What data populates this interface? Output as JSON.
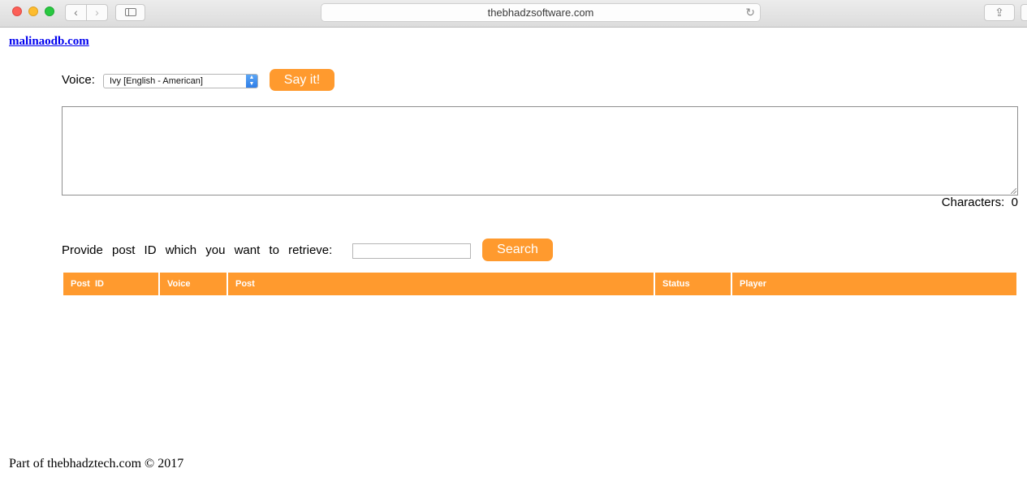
{
  "browser": {
    "url": "thebhadzsoftware.com"
  },
  "page": {
    "site_link": "malinaodb.com",
    "voice_label": "Voice:",
    "voice_selected": "Ivy [English - American]",
    "say_button": "Say it!",
    "characters_label": "Characters:",
    "characters_value": "0",
    "retrieve_label": "Provide post ID which you want to retrieve:",
    "search_button": "Search",
    "table_headers": [
      "Post  ID",
      "Voice",
      "Post",
      "Status",
      "Player"
    ],
    "footer": "Part of thebhadztech.com © 2017"
  },
  "colors": {
    "accent": "#ff9a2e",
    "link": "#0000ee"
  }
}
